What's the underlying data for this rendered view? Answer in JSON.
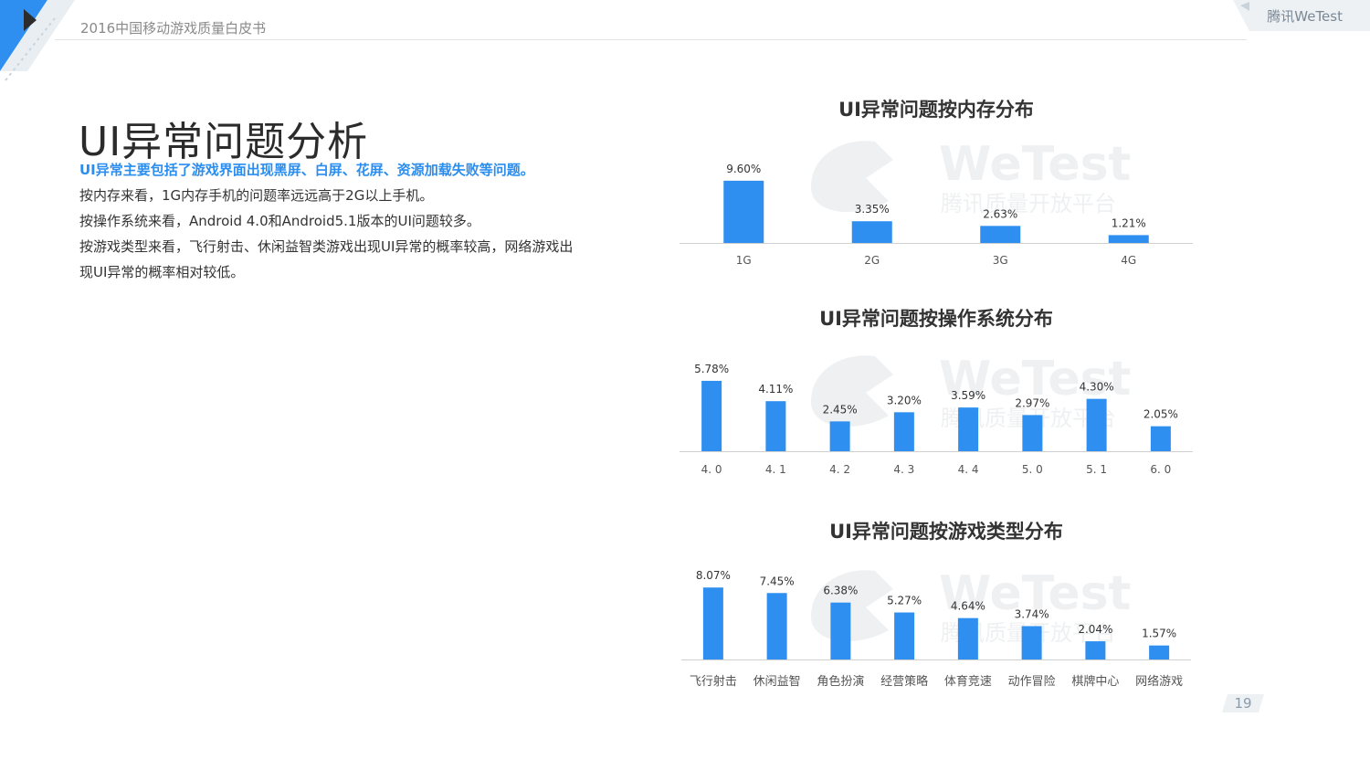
{
  "header": {
    "title": "2016中国移动游戏质量白皮书",
    "brand": "腾讯WeTest"
  },
  "page_title": "UI异常问题分析",
  "description": {
    "lead": "UI异常主要包括了游戏界面出现黑屏、白屏、花屏、资源加载失败等问题。",
    "lines": [
      "按内存来看，1G内存手机的问题率远远高于2G以上手机。",
      "按操作系统来看，Android 4.0和Android5.1版本的UI问题较多。",
      "按游戏类型来看，飞行射击、休闲益智类游戏出现UI异常的概率较高，网络游戏出现UI异常的概率相对较低。"
    ]
  },
  "watermark": {
    "brand": "WeTest",
    "sub": "腾讯质量开放平台"
  },
  "page_number": "19",
  "colors": {
    "bar": "#2e8ff0",
    "accent": "#2a8ef0",
    "axis": "#d0d0d0"
  },
  "chart_data": [
    {
      "type": "bar",
      "title": "UI异常问题按内存分布",
      "categories": [
        "1G",
        "2G",
        "3G",
        "4G"
      ],
      "values": [
        9.6,
        3.35,
        2.63,
        1.21
      ],
      "labels": [
        "9.60%",
        "3.35%",
        "2.63%",
        "1.21%"
      ],
      "ylim": [
        0,
        10
      ],
      "grid": false,
      "legend": "none"
    },
    {
      "type": "bar",
      "title": "UI异常问题按操作系统分布",
      "categories": [
        "4. 0",
        "4. 1",
        "4. 2",
        "4. 3",
        "4. 4",
        "5. 0",
        "5. 1",
        "6. 0"
      ],
      "values": [
        5.78,
        4.11,
        2.45,
        3.2,
        3.59,
        2.97,
        4.3,
        2.05
      ],
      "labels": [
        "5.78%",
        "4.11%",
        "2.45%",
        "3.20%",
        "3.59%",
        "2.97%",
        "4.30%",
        "2.05%"
      ],
      "ylim": [
        0,
        6
      ],
      "grid": false,
      "legend": "none"
    },
    {
      "type": "bar",
      "title": "UI异常问题按游戏类型分布",
      "categories": [
        "飞行射击",
        "休闲益智",
        "角色扮演",
        "经营策略",
        "体育竞速",
        "动作冒险",
        "棋牌中心",
        "网络游戏"
      ],
      "values": [
        8.07,
        7.45,
        6.38,
        5.27,
        4.64,
        3.74,
        2.04,
        1.57
      ],
      "labels": [
        "8.07%",
        "7.45%",
        "6.38%",
        "5.27%",
        "4.64%",
        "3.74%",
        "2.04%",
        "1.57%"
      ],
      "ylim": [
        0,
        8.5
      ],
      "grid": false,
      "legend": "none"
    }
  ]
}
